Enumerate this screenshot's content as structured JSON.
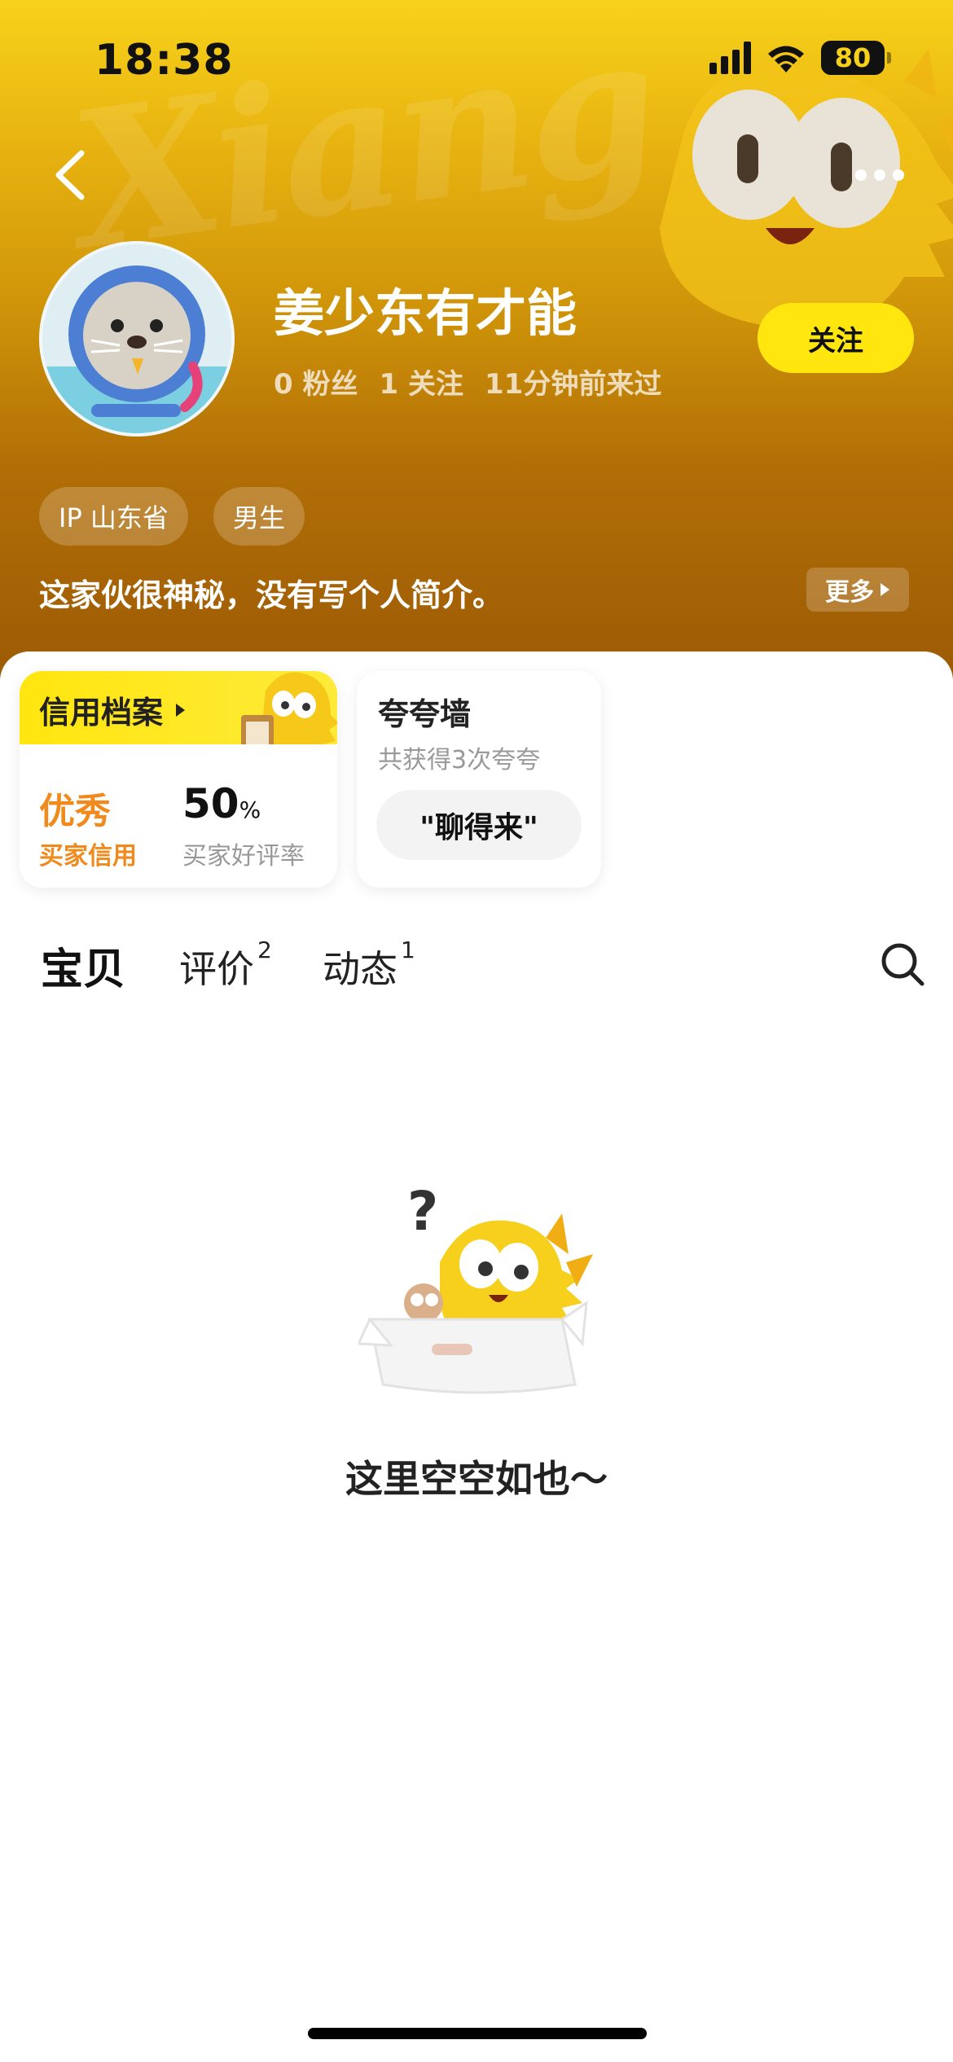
{
  "status_bar": {
    "time": "18:38",
    "battery": "80"
  },
  "profile": {
    "name": "姜少东有才能",
    "fans": "0 粉丝",
    "following": "1 关注",
    "last_seen": "11分钟前来过",
    "follow_label": "关注",
    "tags": [
      "IP 山东省",
      "男生"
    ],
    "bio": "这家伙很神秘，没有写个人简介。",
    "more_label": "更多"
  },
  "credit": {
    "title": "信用档案",
    "level": "优秀",
    "level_label": "买家信用",
    "rate": "50",
    "rate_unit": "%",
    "rate_label": "买家好评率"
  },
  "praise": {
    "title": "夸夸墙",
    "subtitle": "共获得3次夸夸",
    "pill": "\"聊得来\""
  },
  "tabs": [
    {
      "label": "宝贝",
      "count": ""
    },
    {
      "label": "评价",
      "count": "2"
    },
    {
      "label": "动态",
      "count": "1"
    }
  ],
  "empty": {
    "text": "这里空空如也～"
  },
  "colors": {
    "brand_yellow": "#ffe60f",
    "credit_orange": "#f08a1c"
  }
}
